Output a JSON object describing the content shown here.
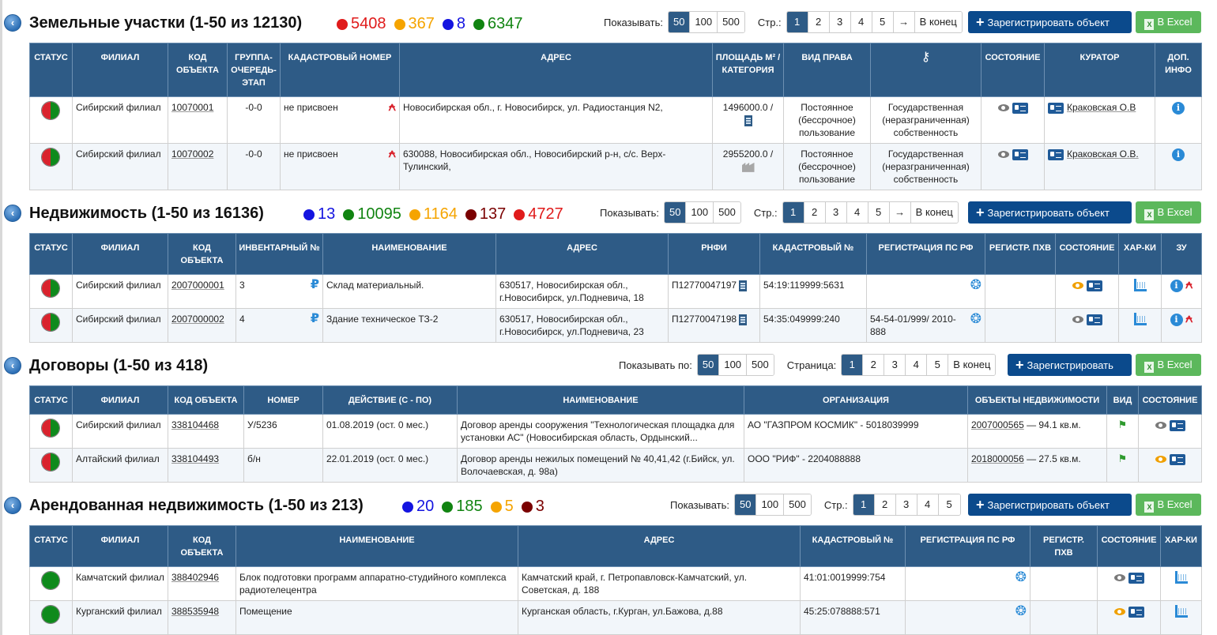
{
  "land": {
    "title": "Земельные участки (1-50 из 12130)",
    "counts": [
      {
        "value": "5408",
        "color": "#e01b1b"
      },
      {
        "value": "367",
        "color": "#f5a400"
      },
      {
        "value": "8",
        "color": "#1414e0"
      },
      {
        "value": "6347",
        "color": "#118411"
      }
    ],
    "show_label": "Показывать:",
    "show_opts": [
      "50",
      "100",
      "500"
    ],
    "page_label": "Стр.:",
    "pages": [
      "1",
      "2",
      "3",
      "4",
      "5",
      "→",
      "В конец"
    ],
    "register": "Зарегистрировать объект",
    "excel": "В Excel",
    "headers": [
      "СТАТУС",
      "ФИЛИАЛ",
      "КОД ОБЪЕКТА",
      "ГРУППА-ОЧЕРЕДЬ-ЭТАП",
      "КАДАСТРОВЫЙ НОМЕР",
      "АДРЕС",
      "ПЛОЩАДЬ М² /КАТЕГОРИЯ",
      "ВИД ПРАВА",
      "",
      "СОСТОЯНИЕ",
      "КУРАТОР",
      "ДОП. ИНФО"
    ],
    "rows": [
      {
        "branch": "Сибирский филиал",
        "code": "10070001",
        "group": "-0-0",
        "cad": "не присвоен",
        "addr": "Новосибирская обл., г. Новосибирск, ул. Радиостанция N2,",
        "area": "1496000.0 /",
        "right": "Постоянное (бессрочное) пользование",
        "owner": "Государственная (неразграниченная) собственность",
        "curator": "Краковская О.В"
      },
      {
        "branch": "Сибирский филиал",
        "code": "10070002",
        "group": "-0-0",
        "cad": "не присвоен",
        "addr": "630088, Новосибирская обл., Новосибирский р-н, с/с. Верх-Тулинский,",
        "area": "2955200.0 /",
        "right": "Постоянное (бессрочное) пользование",
        "owner": "Государственная (неразграниченная) собственность",
        "curator": "Краковская О.В."
      }
    ]
  },
  "realty": {
    "title": "Недвижимость  (1-50 из 16136)",
    "counts": [
      {
        "value": "13",
        "color": "#1414e0"
      },
      {
        "value": "10095",
        "color": "#118411"
      },
      {
        "value": "1164",
        "color": "#f5a400"
      },
      {
        "value": "137",
        "color": "#7a0000"
      },
      {
        "value": "4727",
        "color": "#e01b1b"
      }
    ],
    "show_label": "Показывать:",
    "show_opts": [
      "50",
      "100",
      "500"
    ],
    "page_label": "Стр.:",
    "pages": [
      "1",
      "2",
      "3",
      "4",
      "5",
      "→",
      "В конец"
    ],
    "register": "Зарегистрировать объект",
    "excel": "В Excel",
    "headers": [
      "СТАТУС",
      "ФИЛИАЛ",
      "КОД ОБЪЕКТА",
      "ИНВЕНТАРНЫЙ №",
      "НАИМЕНОВАНИЕ",
      "АДРЕС",
      "РНФИ",
      "КАДАСТРОВЫЙ №",
      "РЕГИСТРАЦИЯ ПС РФ",
      "РЕГИСТР. ПХВ",
      "СОСТОЯНИЕ",
      "ХАР-КИ",
      "ЗУ"
    ],
    "rows": [
      {
        "branch": "Сибирский филиал",
        "code": "2007000001",
        "inv": "3",
        "name": "Склад материальный.",
        "addr": "630517, Новосибирская обл., г.Новосибирск, ул.Подневича, 18",
        "rnfi": "П12770047197",
        "cad": "54:19:119999:5631",
        "reg": ""
      },
      {
        "branch": "Сибирский филиал",
        "code": "2007000002",
        "inv": "4",
        "name": "Здание техническое ТЗ-2",
        "addr": "630517, Новосибирская обл., г.Новосибирск, ул.Подневича, 23",
        "rnfi": "П12770047198",
        "cad": "54:35:049999:240",
        "reg": "54-54-01/999/ 2010-888"
      }
    ]
  },
  "contracts": {
    "title": "Договоры (1-50 из 418)",
    "show_label": "Показывать по:",
    "show_opts": [
      "50",
      "100",
      "500"
    ],
    "page_label": "Страница:",
    "pages": [
      "1",
      "2",
      "3",
      "4",
      "5",
      "В конец"
    ],
    "register": "Зарегистрировать",
    "excel": "В Excel",
    "headers": [
      "СТАТУС",
      "ФИЛИАЛ",
      "КОД ОБЪЕКТА",
      "НОМЕР",
      "ДЕЙСТВИЕ (С - ПО)",
      "НАИМЕНОВАНИЕ",
      "ОРГАНИЗАЦИЯ",
      "ОБЪЕКТЫ НЕДВИЖИМОСТИ",
      "ВИД",
      "СОСТОЯНИЕ"
    ],
    "rows": [
      {
        "branch": "Сибирский филиал",
        "code": "338104468",
        "num": "У/5236",
        "period": "01.08.2019 (ост. 0 мес.)",
        "name": "Договор аренды сооружения \"Технологическая площадка для установки АС\" (Новосибирская область, Ордынский...",
        "org": "АО \"ГАЗПРОМ КОСМИК\" - 5018039999",
        "obj_code": "2007000565",
        "obj_rest": " — 94.1 кв.м."
      },
      {
        "branch": "Алтайский филиал",
        "code": "338104493",
        "num": "б/н",
        "period": "22.01.2019 (ост. 0 мес.)",
        "name": "Договор аренды нежилых помещений № 40,41,42 (г.Бийск, ул. Волочаевская, д. 98а)",
        "org": "ООО \"РИФ\" - 2204088888",
        "obj_code": "2018000056",
        "obj_rest": " — 27.5 кв.м."
      }
    ]
  },
  "leased": {
    "title": "Арендованная недвижимость  (1-50 из 213)",
    "counts": [
      {
        "value": "20",
        "color": "#1414e0"
      },
      {
        "value": "185",
        "color": "#118411"
      },
      {
        "value": "5",
        "color": "#f5a400"
      },
      {
        "value": "3",
        "color": "#7a0000"
      }
    ],
    "show_label": "Показывать:",
    "show_opts": [
      "50",
      "100",
      "500"
    ],
    "page_label": "Стр.:",
    "pages": [
      "1",
      "2",
      "3",
      "4",
      "5"
    ],
    "register": "Зарегистрировать объект",
    "excel": "В Excel",
    "headers": [
      "СТАТУС",
      "ФИЛИАЛ",
      "КОД ОБЪЕКТА",
      "НАИМЕНОВАНИЕ",
      "АДРЕС",
      "КАДАСТРОВЫЙ №",
      "РЕГИСТРАЦИЯ ПС РФ",
      "РЕГИСТР. ПХВ",
      "СОСТОЯНИЕ",
      "ХАР-КИ"
    ],
    "rows": [
      {
        "branch": "Камчатский филиал",
        "code": "388402946",
        "name": "Блок подготовки программ аппаратно-студийного комплекса радиотелецентра",
        "addr": "Камчатский край, г. Петропавловск-Камчатский, ул. Советская, д. 188",
        "cad": "41:01:0019999:754"
      },
      {
        "branch": "Курганский филиал",
        "code": "388535948",
        "name": "Помещение",
        "addr": "Курганская область, г.Курган, ул.Бажова, д.88",
        "cad": "45:25:078888:571"
      }
    ]
  },
  "icons": {
    "collapse": "chevron-left-icon",
    "key": "key-icon",
    "eye": "eye-icon",
    "card": "id-card-icon",
    "info": "info-icon",
    "cadastral": "cadastral-map-icon",
    "ruble": "ruble-icon",
    "building": "building-icon",
    "factory": "factory-icon",
    "medal": "certificate-icon",
    "ruler": "ruler-icon",
    "flag": "flag-icon",
    "excel": "excel-icon",
    "plus": "plus-icon"
  },
  "colors": {
    "header_bg": "#2e5b86",
    "primary_button": "#0b4a8c",
    "excel_button": "#5cb85c",
    "status_red": "#d9232d",
    "status_green": "#0f8a1c"
  }
}
